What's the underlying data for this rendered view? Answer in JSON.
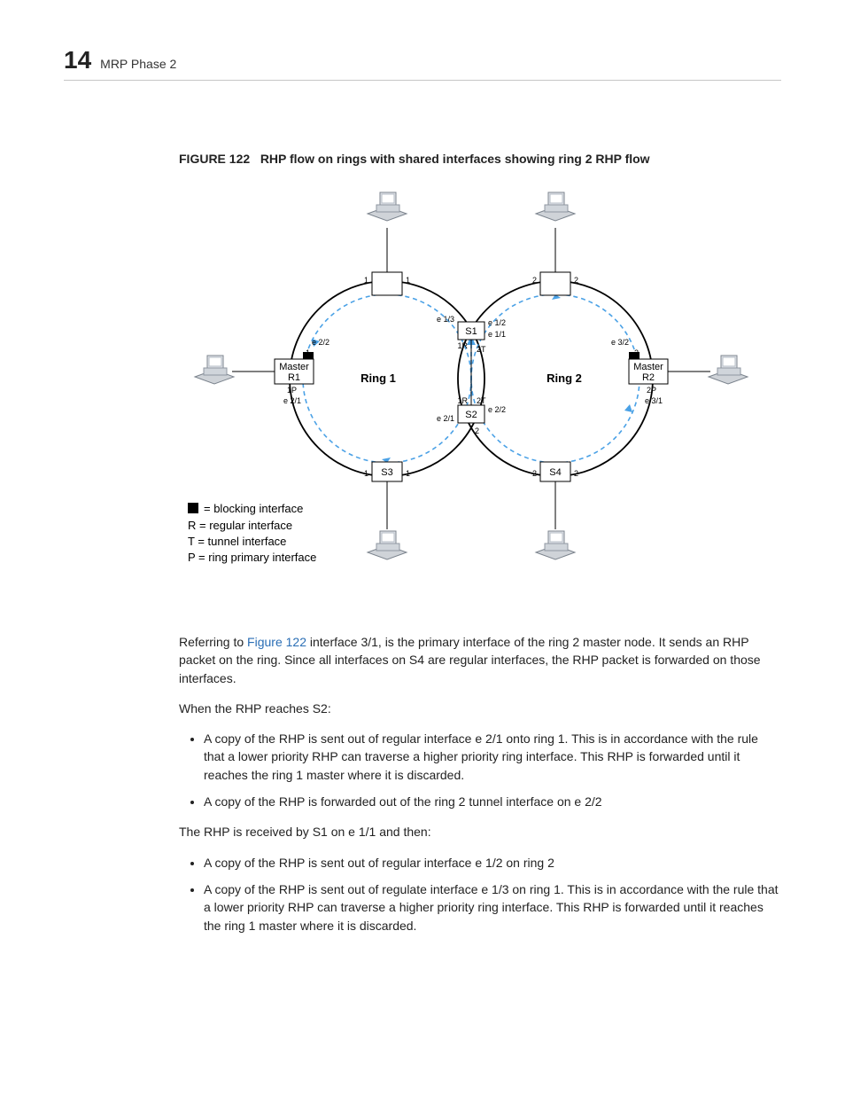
{
  "header": {
    "chapter_number": "14",
    "chapter_title": "MRP Phase 2"
  },
  "figure": {
    "label": "FIGURE 122",
    "title": "RHP flow on rings with shared interfaces showing ring 2 RHP flow",
    "ring1_label": "Ring 1",
    "ring2_label": "Ring 2",
    "nodes": {
      "r1_top": "Master",
      "r1_bottom": "R1",
      "r2_top": "Master",
      "r2_bottom": "R2",
      "s1": "S1",
      "s2": "S2",
      "s3": "S3",
      "s4": "S4"
    },
    "ports": {
      "r1_top_port": "1",
      "r1_bot_port": "1P",
      "r1_if_top": "e 2/2",
      "r1_if_bot": "e 2/1",
      "r2_top_port": "2",
      "r2_bot_port": "2P",
      "r2_if_top": "e 3/2",
      "r2_if_bot": "e 3/1",
      "s1_l": "e 1/3",
      "s1_r": "e 1/2",
      "s1_b": "e 1/1",
      "s1_br": "1R",
      "s2_l": "e 2/1",
      "s2_r": "e 2/2",
      "s2_t": "2T",
      "s2_tl": "1R",
      "s2_tr": "2T",
      "top_tl": "1",
      "top_tr": "1",
      "top2_tl": "2",
      "top2_tr": "2",
      "s3_l": "1",
      "s3_r": "1",
      "s4_l": "2",
      "s4_r": "2",
      "s2_b": "2"
    },
    "legend": {
      "block": "= blocking interface",
      "r": "R = regular interface",
      "t": "T = tunnel interface",
      "p": "P = ring primary interface"
    }
  },
  "para1_pre": "Referring to ",
  "para1_link": "Figure 122",
  "para1_post": " interface 3/1, is the primary interface of the ring 2 master node. It sends an RHP packet on the ring. Since all interfaces on S4 are regular interfaces, the RHP packet is forwarded on those interfaces.",
  "para2": "When the RHP reaches S2:",
  "bullets1": [
    "A copy of the RHP is sent out of regular interface e 2/1 onto ring 1. This is in accordance with the rule that a lower priority RHP can traverse a higher priority ring interface. This RHP is forwarded until it reaches the ring 1 master where it is discarded.",
    "A copy of the RHP is forwarded out of the ring 2 tunnel interface on e 2/2"
  ],
  "para3": "The RHP is received by S1 on e 1/1 and then:",
  "bullets2": [
    "A copy of the RHP is sent out of regular interface e 1/2 on ring 2",
    "A copy of the RHP is sent out of regulate interface e 1/3 on ring 1. This is in accordance with the rule that a lower priority RHP can traverse a higher priority ring interface. This RHP is forwarded until it reaches the ring 1 master where it is discarded."
  ]
}
